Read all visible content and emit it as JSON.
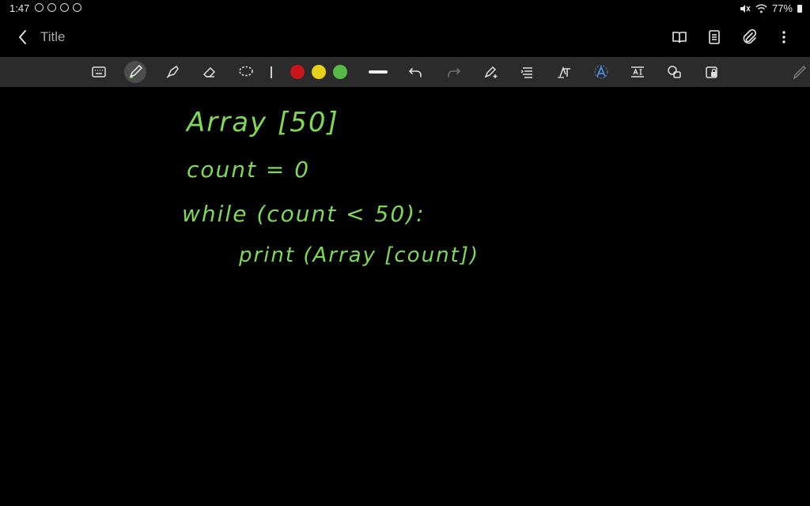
{
  "status_bar": {
    "time": "1:47",
    "battery": "77%"
  },
  "title_bar": {
    "title": "Title"
  },
  "toolbar": {
    "pen_colors": [
      "#c8161d",
      "#e6d11a",
      "#58b947"
    ]
  },
  "note": {
    "lines": [
      "Array [50]",
      "count = 0",
      "while (count < 50):",
      "print (Array [count])"
    ]
  }
}
